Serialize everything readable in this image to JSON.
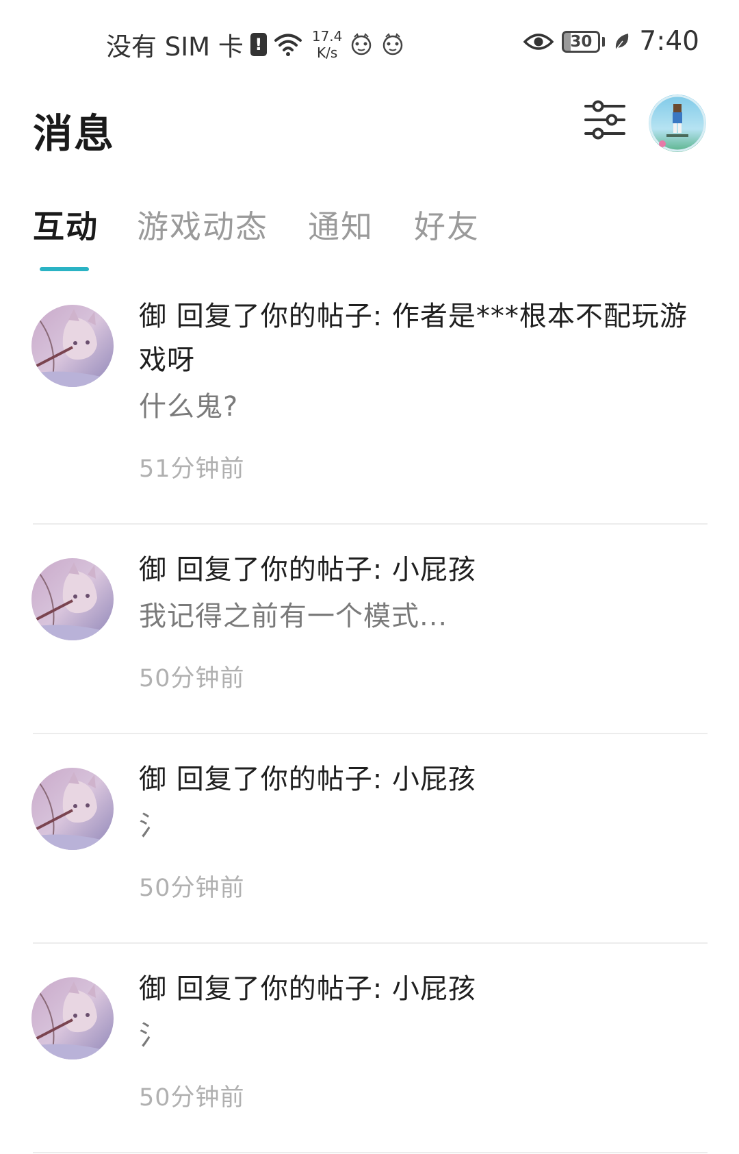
{
  "status_bar": {
    "carrier": "没有 SIM 卡",
    "sim_alert": "!",
    "net_speed_value": "17.4",
    "net_speed_unit": "K/s",
    "battery": "30",
    "time": "7:40"
  },
  "header": {
    "title": "消息"
  },
  "tabs": [
    {
      "label": "互动",
      "active": true
    },
    {
      "label": "游戏动态",
      "active": false
    },
    {
      "label": "通知",
      "active": false
    },
    {
      "label": "好友",
      "active": false
    }
  ],
  "messages": [
    {
      "title": "御 回复了你的帖子: 作者是***根本不配玩游戏呀",
      "preview": "什么鬼?",
      "time": "51分钟前"
    },
    {
      "title": "御 回复了你的帖子: 小屁孩",
      "preview": "我记得之前有一个模式...",
      "time": "50分钟前"
    },
    {
      "title": "御 回复了你的帖子: 小屁孩",
      "preview": "氵",
      "time": "50分钟前"
    },
    {
      "title": "御 回复了你的帖子: 小屁孩",
      "preview": "氵",
      "time": "50分钟前"
    }
  ],
  "colors": {
    "accent": "#2ab3c4",
    "active_tab": "#1a1a1a",
    "inactive_tab": "#9a9a9a",
    "time_text": "#b0b0b0"
  },
  "icons": {
    "filter": "sliders-icon",
    "eye": "eye-icon",
    "leaf": "leaf-icon",
    "wifi": "wifi-icon"
  }
}
